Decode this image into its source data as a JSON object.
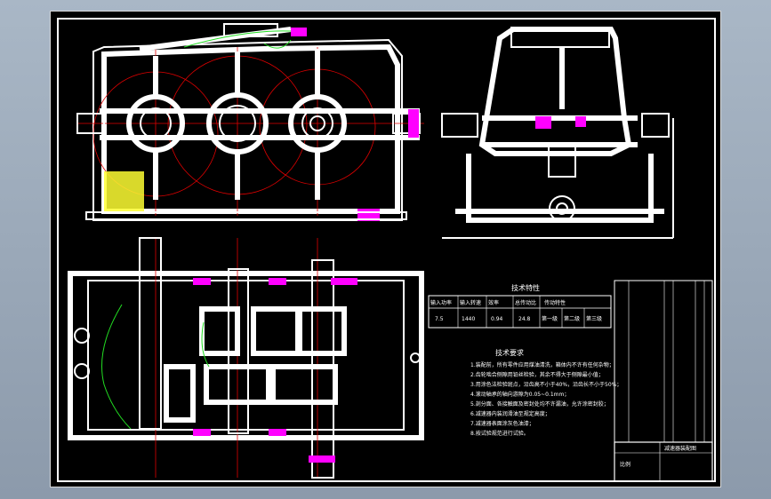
{
  "drawing": {
    "notes_heading": "技术要求",
    "table_heading": "技术特性",
    "notes": [
      "1.装配前，所有零件应用煤油清洗，箱体内不许有任何杂物；",
      "2.齿轮啮合侧隙用铅丝检验，其余不得大于侧隙最小值；",
      "3.用涂色法检验斑点，沿齿高不小于40%，沿齿长不小于50%；",
      "4.滚动轴承的轴向游隙为0.05~0.1mm；",
      "5.剖分面、各接触面及密封处均不许漏油，允许涂密封胶；",
      "6.减速器内装润滑油至规定高度；",
      "7.减速器表面涂灰色油漆；",
      "8.按试验规范进行试验。"
    ],
    "spec_header": [
      "输入功率",
      "输入转速",
      "效率",
      "总传动比",
      "传动特性"
    ],
    "spec_values": [
      "7.5",
      "1440",
      "0.94",
      "24.8",
      "第一级",
      "第二级",
      "第三级"
    ],
    "title_block": {
      "drawing_name": "减速器装配图",
      "label": "比例"
    }
  },
  "colors": {
    "background": "#000000",
    "outline": "#ffffff",
    "center_lines": "#e00000",
    "section_fill": "#ff00ff",
    "accent_line": "#22dd22",
    "hatch": "#ffff33"
  }
}
